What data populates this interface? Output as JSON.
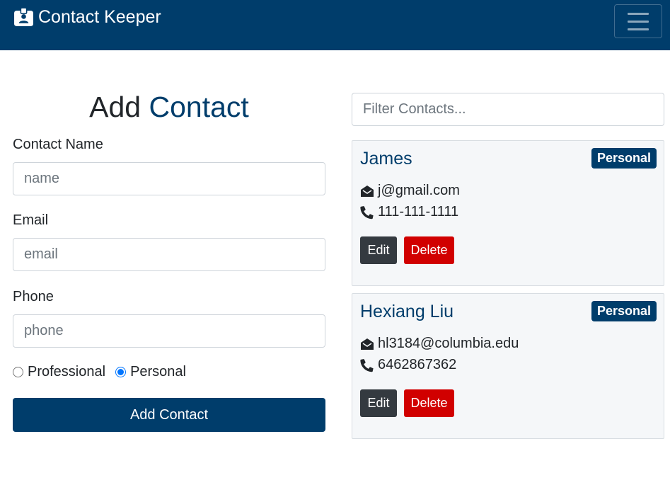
{
  "navbar": {
    "brand_icon": "id-badge-icon",
    "brand_text": "Contact Keeper",
    "menu_icon": "hamburger-icon"
  },
  "form": {
    "title_prefix": "Add",
    "title_accent": "Contact",
    "name_label": "Contact Name",
    "name_placeholder": "name",
    "email_label": "Email",
    "email_placeholder": "email",
    "phone_label": "Phone",
    "phone_placeholder": "phone",
    "type_options": [
      "Professional",
      "Personal"
    ],
    "selected_type": "Personal",
    "submit_label": "Add Contact"
  },
  "filter": {
    "placeholder": "Filter Contacts..."
  },
  "contacts": [
    {
      "name": "James",
      "type": "Personal",
      "email": "j@gmail.com",
      "phone": "111-111-1111",
      "edit_label": "Edit",
      "delete_label": "Delete"
    },
    {
      "name": "Hexiang Liu",
      "type": "Personal",
      "email": "hl3184@columbia.edu",
      "phone": "6462867362",
      "edit_label": "Edit",
      "delete_label": "Delete"
    }
  ],
  "colors": {
    "primary": "#003d6b",
    "danger": "#d10000",
    "dark": "#343a40"
  }
}
